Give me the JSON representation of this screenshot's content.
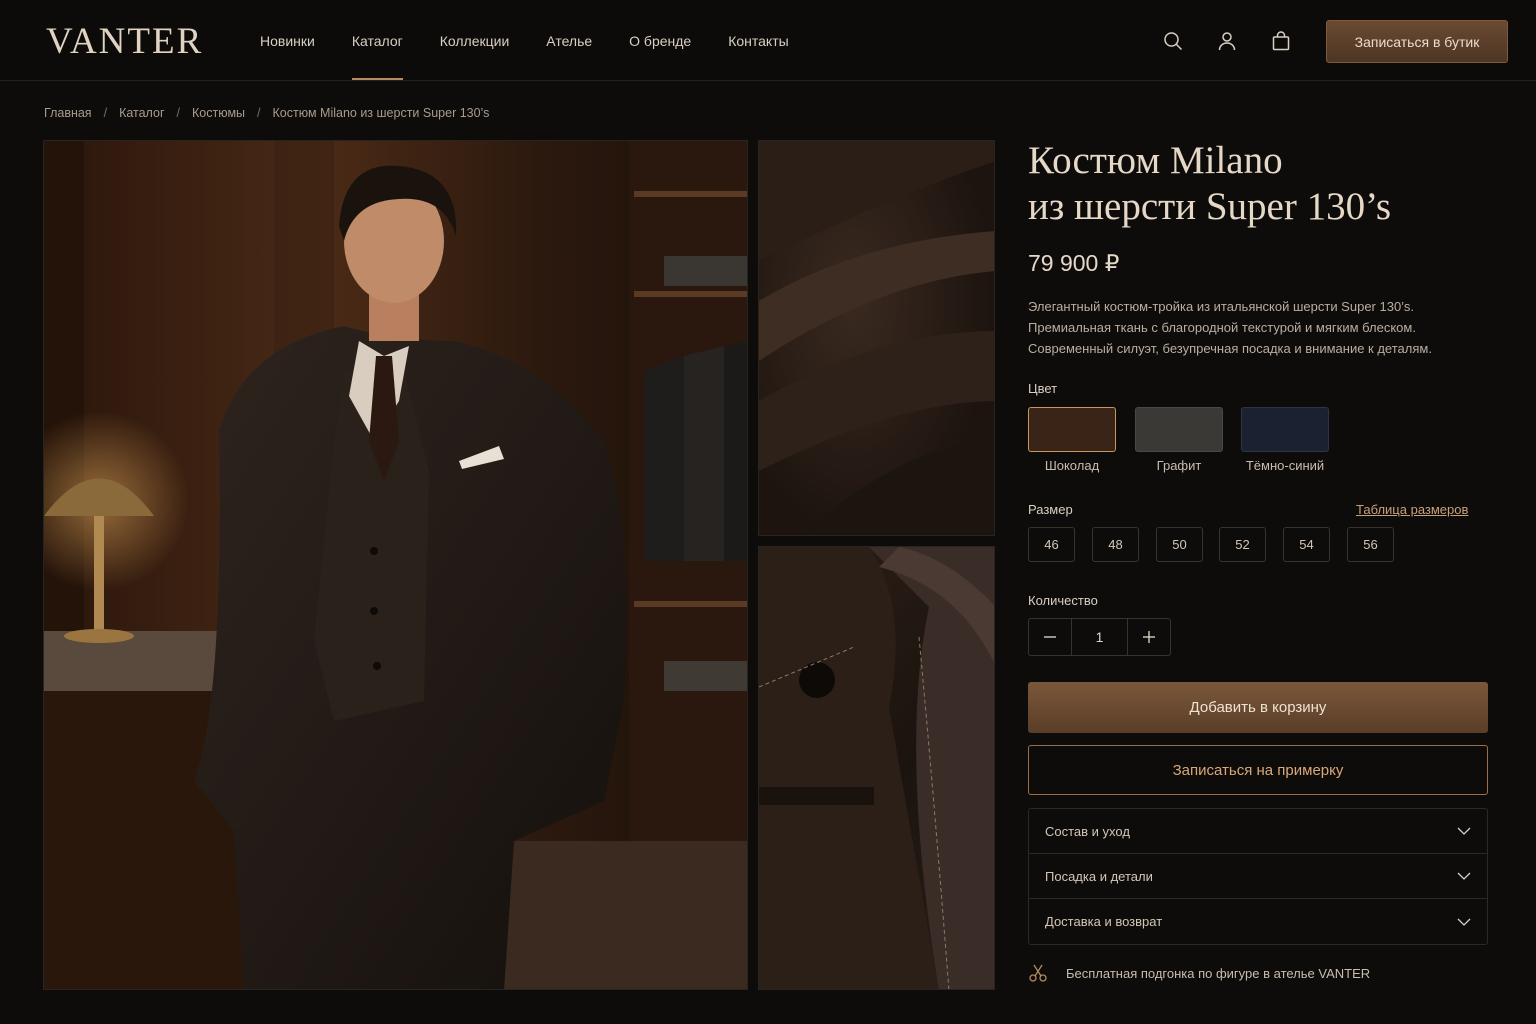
{
  "brand": {
    "logo": "VANTER"
  },
  "nav": {
    "items": [
      "Новинки",
      "Каталог",
      "Коллекции",
      "Ателье",
      "О бренде",
      "Контакты"
    ],
    "active_index": 1,
    "cta": "Записаться в бутик",
    "icons": [
      "search-icon",
      "user-icon",
      "bag-icon"
    ]
  },
  "breadcrumb": [
    "Главная",
    "Каталог",
    "Костюмы",
    "Костюм Milano из шерсти Super 130’s"
  ],
  "breadcrumb_separator": "/",
  "product": {
    "title_line1": "Костюм Milano",
    "title_line2": "из шерсти Super 130’s",
    "price": "79 900 ₽",
    "description": [
      "Элегантный костюм-тройка из итальянской шерсти Super 130’s.",
      "Премиальная ткань с благородной текстурой и мягким блеском.",
      "Современный силуэт, безупречная посадка и внимание к деталям."
    ],
    "color_label": "Цвет",
    "colors": [
      {
        "name": "Шоколад",
        "hex": "#3a2417",
        "selected": true
      },
      {
        "name": "Графит",
        "hex": "#3a3935",
        "selected": false
      },
      {
        "name": "Тёмно-синий",
        "hex": "#1a2232",
        "selected": false
      }
    ],
    "size_label": "Размер",
    "size_chart_link": "Таблица размеров",
    "sizes": [
      "46",
      "48",
      "50",
      "52",
      "54",
      "56"
    ],
    "quantity_label": "Количество",
    "quantity": "1",
    "add_to_cart": "Добавить в корзину",
    "book_fitting": "Записаться на примерку",
    "accordion": [
      "Состав и уход",
      "Посадка и детали",
      "Доставка и возврат"
    ],
    "free_fitting_note": "Бесплатная подгонка по фигуре в ателье VANTER"
  },
  "colors": {
    "accent": "#b58a5c",
    "background": "#0e0c0b",
    "cta_gradient_top": "#7a573a"
  }
}
